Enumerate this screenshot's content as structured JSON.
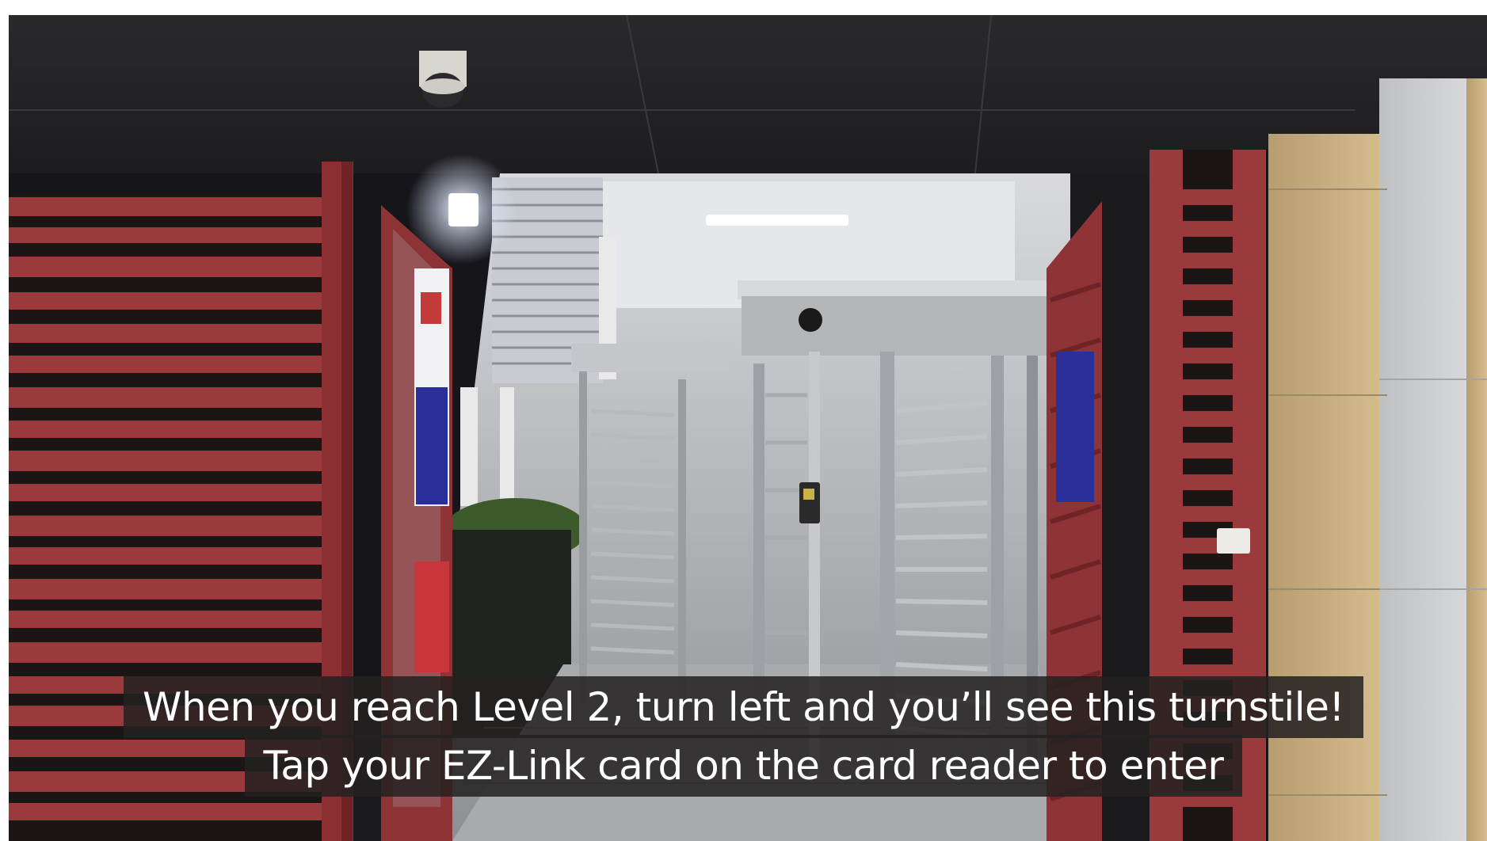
{
  "video_frame": {
    "description_icon": "photo-scene",
    "colors": {
      "ceiling": "#242326",
      "gate_red": "#9b3a3c",
      "gate_red_dark": "#6e2326",
      "steel": "#b9bcc0",
      "pillar_tan": "#c9b07f",
      "pillar_grey": "#cfd0d4",
      "sign_blue": "#2a2f9a",
      "caption_bg": "#242121"
    }
  },
  "captions": {
    "line1": "When you reach Level 2, turn left and you’ll see this turnstile!",
    "line2": "Tap your EZ-Link card on the card reader to enter"
  }
}
